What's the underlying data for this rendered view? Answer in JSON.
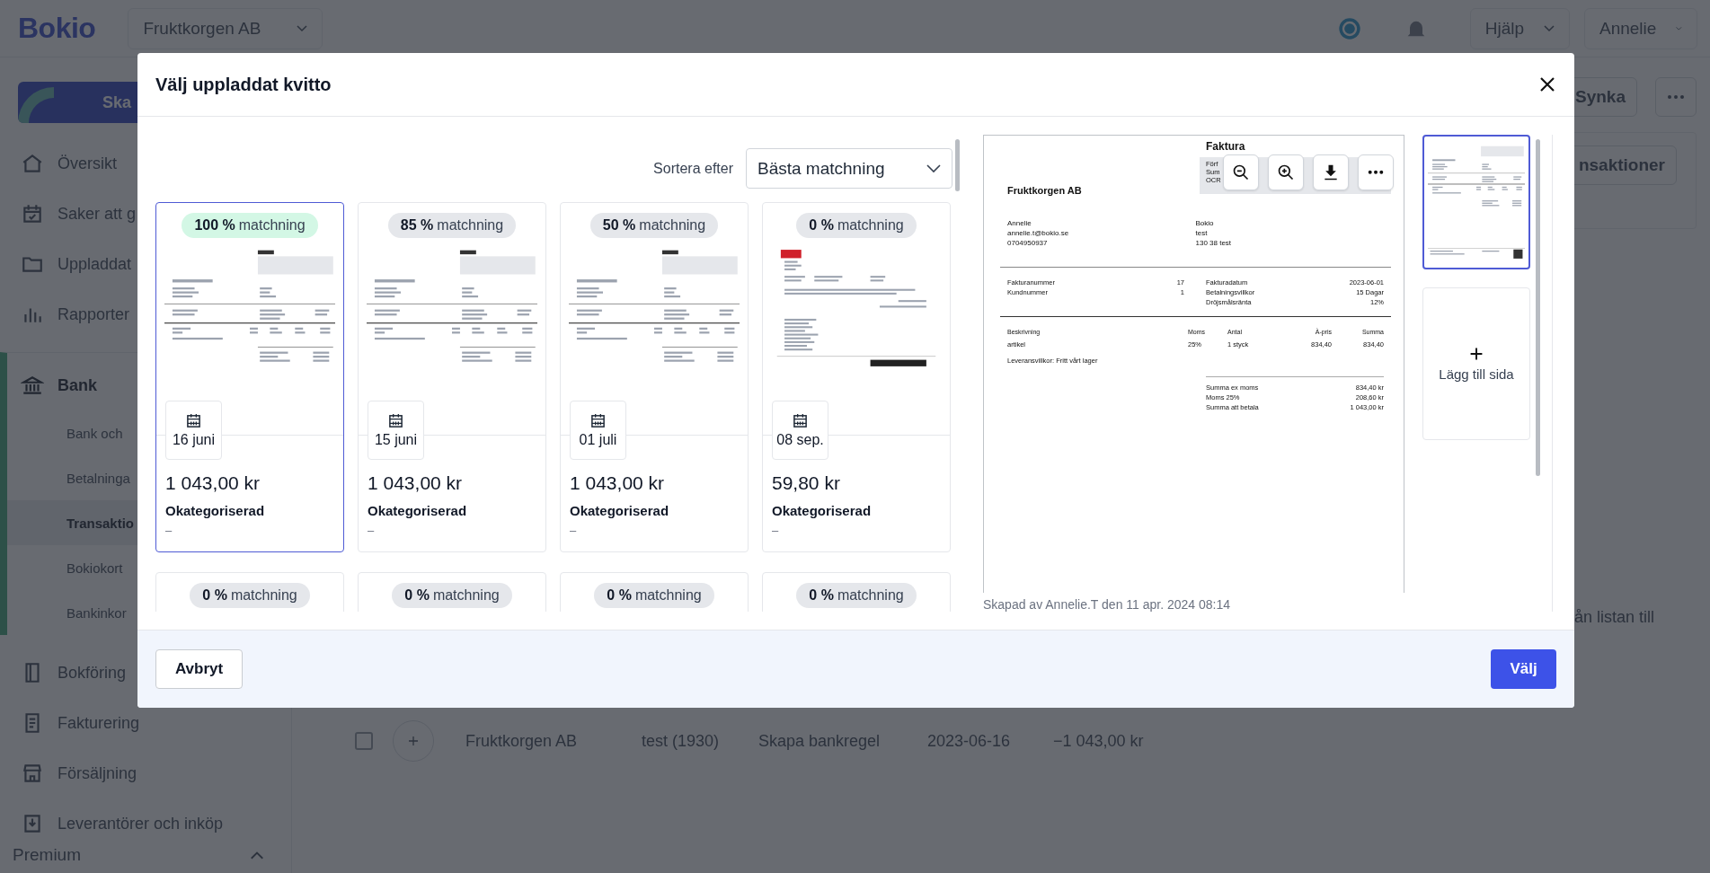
{
  "app": {
    "logo": "Bokio",
    "company": "Fruktkorgen AB",
    "help": "Hjälp",
    "user": "Annelie"
  },
  "sidebar": {
    "action": "Ska",
    "items": [
      {
        "label": "Översikt"
      },
      {
        "label": "Saker att g"
      },
      {
        "label": "Uppladdat"
      },
      {
        "label": "Rapporter"
      },
      {
        "label": "Bank",
        "expanded": true,
        "children": [
          {
            "label": "Bank och",
            "selected": false
          },
          {
            "label": "Betalninga",
            "selected": false
          },
          {
            "label": "Transaktio",
            "selected": true
          },
          {
            "label": "Bokiokort",
            "selected": false
          },
          {
            "label": "Bankinkor",
            "selected": false
          }
        ]
      },
      {
        "label": "Bokföring"
      },
      {
        "label": "Fakturering"
      },
      {
        "label": "Försäljning"
      },
      {
        "label": "Leverantörer och inköp"
      }
    ],
    "premium": "Premium"
  },
  "main": {
    "sync": "Synka",
    "panel_button": "nsaktioner",
    "hint": "ån listan till",
    "row": {
      "checked": false,
      "cells": [
        "Fruktkorgen AB",
        "test (1930)",
        "Skapa bankregel",
        "2023-06-16",
        "−1 043,00 kr"
      ]
    }
  },
  "modal": {
    "title": "Välj uppladdat kvitto",
    "sort": {
      "label": "Sortera efter",
      "value": "Bästa matchning"
    },
    "cards": [
      {
        "match": "**100 %** matchning",
        "color": "#d3f7e5",
        "kind": "invoice",
        "date": "16 juni",
        "amount": "1 043,00 kr",
        "category": "Okategoriserad",
        "note": "–",
        "selected": true
      },
      {
        "match": "**85 %** matchning",
        "color": "#e5e7eb",
        "kind": "invoice",
        "date": "15 juni",
        "amount": "1 043,00 kr",
        "category": "Okategoriserad",
        "note": "–",
        "selected": false
      },
      {
        "match": "**50 %** matchning",
        "color": "#e5e7eb",
        "kind": "invoice",
        "date": "01 juli",
        "amount": "1 043,00 kr",
        "category": "Okategoriserad",
        "note": "–",
        "selected": false
      },
      {
        "match": "**0 %** matchning",
        "color": "#e5e7eb",
        "kind": "receipt",
        "date": "08 sep.",
        "amount": "59,80 kr",
        "category": "Okategoriserad",
        "note": "–",
        "selected": false
      },
      {
        "match": "**0 %** matchning",
        "color": "#e5e7eb",
        "selected": false
      },
      {
        "match": "**0 %** matchning",
        "color": "#e5e7eb",
        "selected": false
      },
      {
        "match": "**0 %** matchning",
        "color": "#e5e7eb",
        "selected": false
      },
      {
        "match": "**0 %** matchning",
        "color": "#e5e7eb",
        "selected": false
      }
    ],
    "document": {
      "title": "Faktura",
      "box_labels": [
        "Förf",
        "Sum",
        "OCR"
      ],
      "seller": "Fruktkorgen AB",
      "sender": [
        "Annelie",
        "annelie.t@bokio.se",
        "0704950937"
      ],
      "recipient": [
        "Bokio",
        "test",
        "130 38 test"
      ],
      "info_left": [
        {
          "label": "Fakturanummer",
          "value": "17"
        },
        {
          "label": "Kundnummer",
          "value": "1"
        }
      ],
      "info_right": [
        {
          "label": "Fakturadatum",
          "value": "2023-06-01"
        },
        {
          "label": "Betalningsvillkor",
          "value": "15 Dagar"
        },
        {
          "label": "Dröjsmålsränta",
          "value": "12%"
        }
      ],
      "columns": [
        "Beskrivning",
        "Moms",
        "Antal",
        "À-pris",
        "Summa"
      ],
      "rows": [
        [
          "artikel",
          "25%",
          "1 styck",
          "834,40",
          "834,40"
        ]
      ],
      "terms": "Leveransvillkor: Fritt vårt lager",
      "totals": [
        {
          "label": "Summa ex moms",
          "value": "834,40 kr"
        },
        {
          "label": "Moms 25%",
          "value": "208,60 kr"
        },
        {
          "label": "Summa att betala",
          "value": "1 043,00 kr"
        }
      ]
    },
    "created": "Skapad av Annelie.T den 11 apr. 2024 08:14",
    "pages": [
      {
        "selected": true
      }
    ],
    "add_page": "Lägg till sida",
    "cancel": "Avbryt",
    "confirm": "Välj"
  }
}
